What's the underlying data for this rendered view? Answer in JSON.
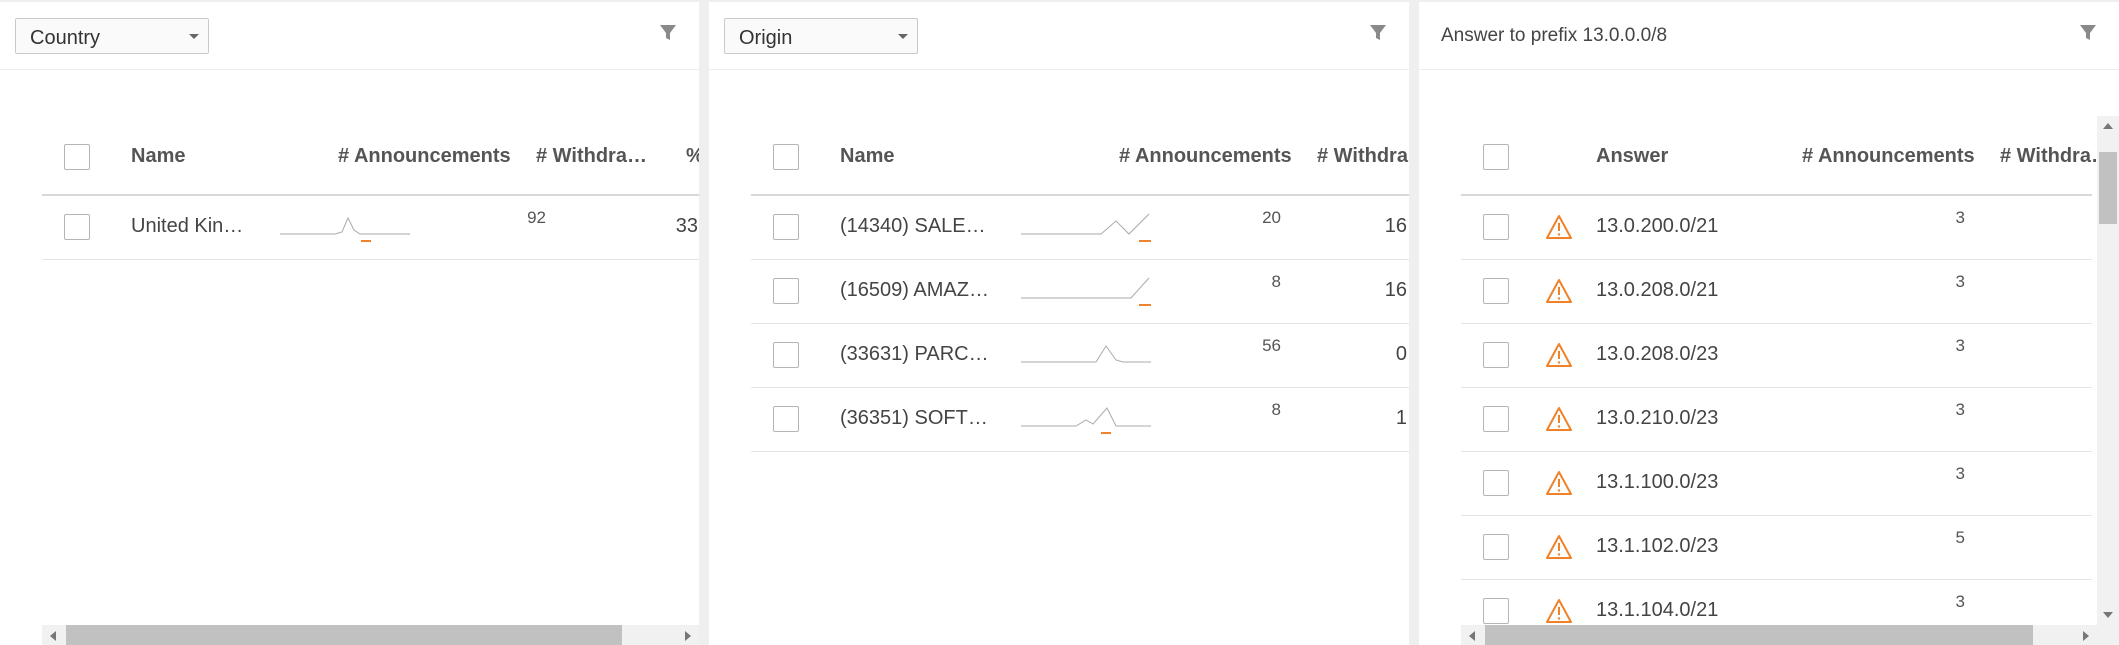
{
  "colors": {
    "accent": "#f0822a",
    "panel_bg": "#ffffff",
    "page_bg": "#efefef"
  },
  "icons": {
    "filter": "filter-icon",
    "warning": "warning-icon",
    "checkbox": "checkbox"
  },
  "country_panel": {
    "dropdown_value": "Country",
    "columns": {
      "name": "Name",
      "announcements": "# Announcements",
      "withdrawals": "# Withdra…",
      "percent": "%"
    },
    "rows": [
      {
        "name": "United Kin…",
        "announcements": "92",
        "withdrawals": "33"
      }
    ]
  },
  "origin_panel": {
    "dropdown_value": "Origin",
    "columns": {
      "name": "Name",
      "announcements": "# Announcements",
      "withdrawals": "# Withdra…"
    },
    "rows": [
      {
        "name": "(14340) SALE…",
        "announcements": "20",
        "withdrawals": "16"
      },
      {
        "name": "(16509) AMAZ…",
        "announcements": "8",
        "withdrawals": "16"
      },
      {
        "name": "(33631) PARC…",
        "announcements": "56",
        "withdrawals": "0"
      },
      {
        "name": "(36351) SOFT…",
        "announcements": "8",
        "withdrawals": "1"
      }
    ]
  },
  "answer_panel": {
    "title": "Answer to prefix 13.0.0.0/8",
    "columns": {
      "answer": "Answer",
      "announcements": "# Announcements",
      "withdrawals": "# Withdra…"
    },
    "rows": [
      {
        "answer": "13.0.200.0/21",
        "announcements": "3"
      },
      {
        "answer": "13.0.208.0/21",
        "announcements": "3"
      },
      {
        "answer": "13.0.208.0/23",
        "announcements": "3"
      },
      {
        "answer": "13.0.210.0/23",
        "announcements": "3"
      },
      {
        "answer": "13.1.100.0/23",
        "announcements": "3"
      },
      {
        "answer": "13.1.102.0/23",
        "announcements": "5"
      },
      {
        "answer": "13.1.104.0/21",
        "announcements": "3"
      }
    ]
  }
}
